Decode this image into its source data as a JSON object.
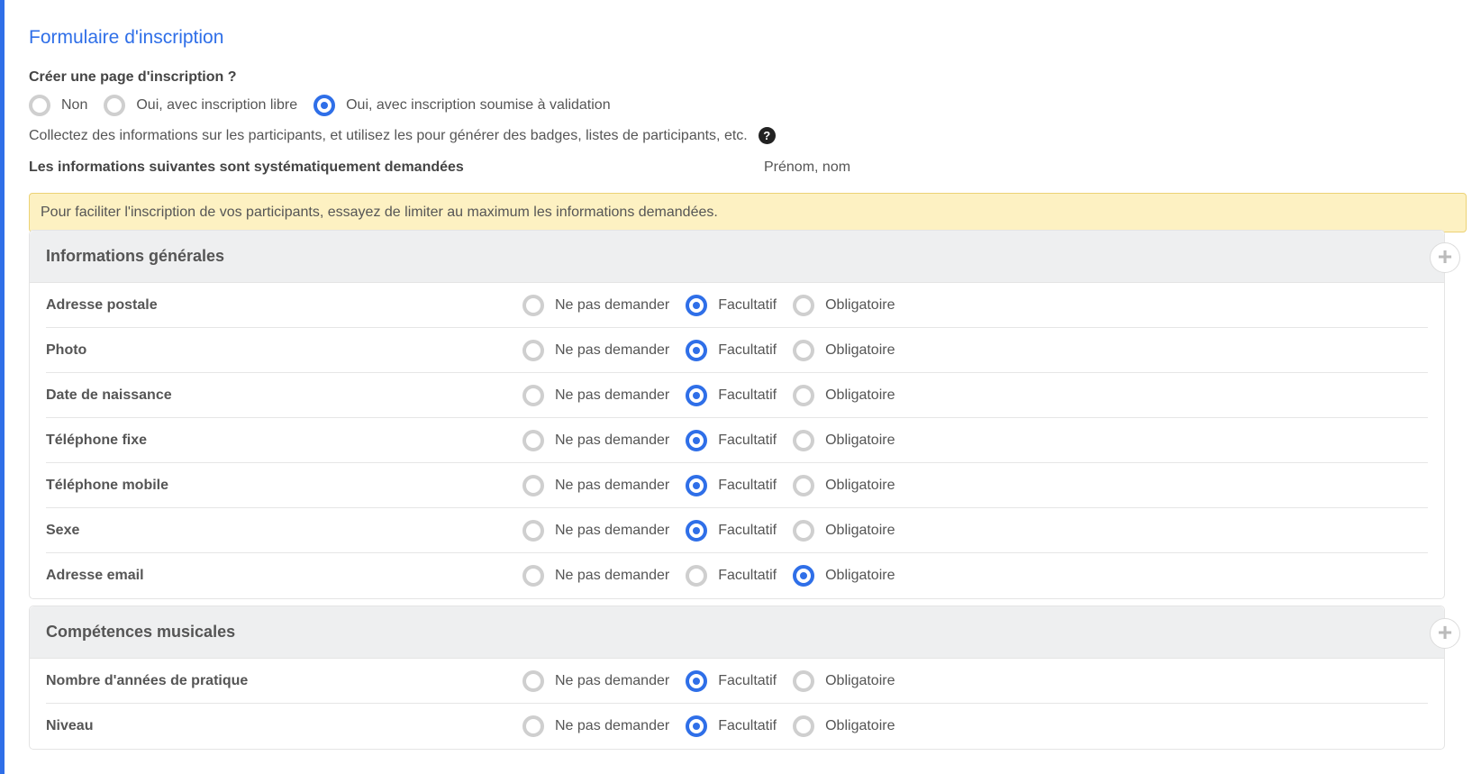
{
  "form": {
    "title": "Formulaire d'inscription",
    "question": "Créer une page d'inscription ?",
    "options": [
      {
        "label": "Non",
        "checked": false
      },
      {
        "label": "Oui, avec inscription libre",
        "checked": false
      },
      {
        "label": "Oui, avec inscription soumise à validation",
        "checked": true
      }
    ],
    "description": "Collectez des informations sur les participants, et utilisez les pour générer des badges, listes de participants, etc.",
    "help_icon": "?",
    "systematic_label": "Les informations suivantes sont systématiquement demandées",
    "systematic_value": "Prénom, nom",
    "alert": "Pour faciliter l'inscription de vos participants, essayez de limiter au maximum les informations demandées.",
    "choice_labels": [
      "Ne pas demander",
      "Facultatif",
      "Obligatoire"
    ],
    "add_symbol": "+"
  },
  "sections": [
    {
      "title": "Informations générales",
      "rows": [
        {
          "label": "Adresse postale",
          "selected": 1
        },
        {
          "label": "Photo",
          "selected": 1
        },
        {
          "label": "Date de naissance",
          "selected": 1
        },
        {
          "label": "Téléphone fixe",
          "selected": 1
        },
        {
          "label": "Téléphone mobile",
          "selected": 1
        },
        {
          "label": "Sexe",
          "selected": 1
        },
        {
          "label": "Adresse email",
          "selected": 2
        }
      ]
    },
    {
      "title": "Compétences musicales",
      "rows": [
        {
          "label": "Nombre d'années de pratique",
          "selected": 1
        },
        {
          "label": "Niveau",
          "selected": 1
        }
      ]
    }
  ],
  "colors": {
    "accent": "#2f6fe8",
    "alert_bg": "#fdf1c2"
  }
}
